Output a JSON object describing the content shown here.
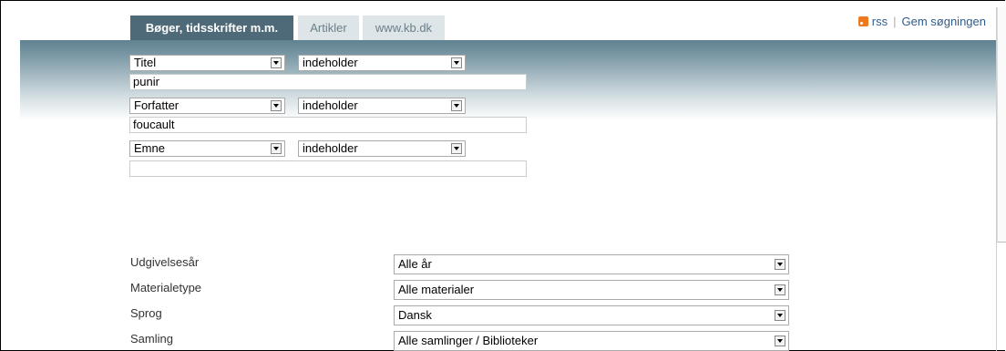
{
  "tabs": [
    {
      "label": "Bøger, tidsskrifter m.m."
    },
    {
      "label": "Artikler"
    },
    {
      "label": "www.kb.dk"
    }
  ],
  "links": {
    "rss": "rss",
    "save_search": "Gem søgningen"
  },
  "search_rows": [
    {
      "field": "Titel",
      "operator": "indeholder",
      "value": "punir"
    },
    {
      "field": "Forfatter",
      "operator": "indeholder",
      "value": "foucault"
    },
    {
      "field": "Emne",
      "operator": "indeholder",
      "value": ""
    }
  ],
  "filters": [
    {
      "label": "Udgivelsesår",
      "value": "Alle år"
    },
    {
      "label": "Materialetype",
      "value": "Alle materialer"
    },
    {
      "label": "Sprog",
      "value": "Dansk"
    },
    {
      "label": "Samling",
      "value": "Alle samlinger / Biblioteker"
    }
  ],
  "colors": {
    "active_tab": "#4e6a78",
    "inactive_tab": "#dde5e8",
    "link": "#2f5b8a",
    "rss": "#ee7a1f"
  }
}
